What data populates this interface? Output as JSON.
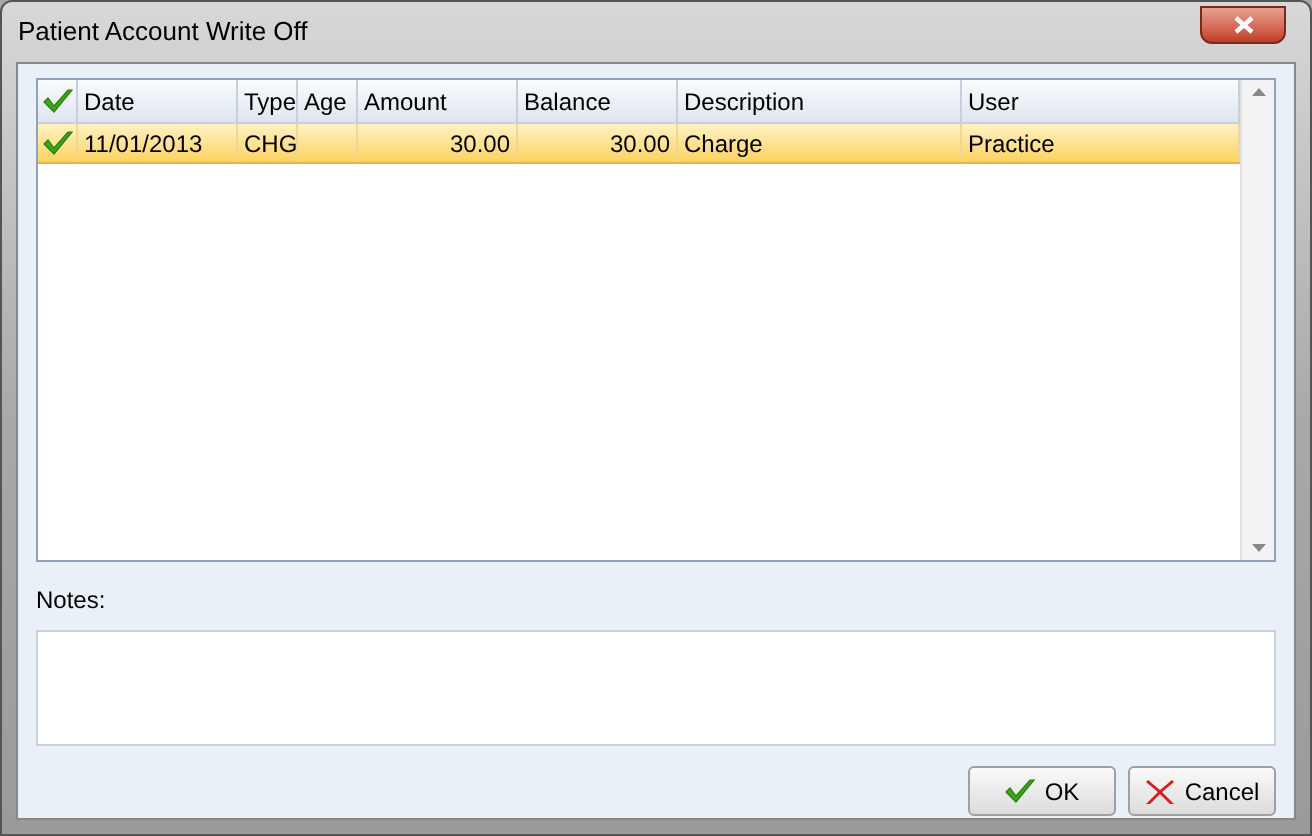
{
  "window": {
    "title": "Patient Account Write Off"
  },
  "table": {
    "columns": [
      "Date",
      "Type",
      "Age",
      "Amount",
      "Balance",
      "Description",
      "User"
    ],
    "rows": [
      {
        "checked": true,
        "selected": true,
        "cells": [
          "11/01/2013",
          "CHG",
          "",
          "30.00",
          "30.00",
          "Charge",
          "Practice"
        ]
      }
    ]
  },
  "notes": {
    "label": "Notes:"
  },
  "buttons": [
    {
      "kind": "ok",
      "label": "OK"
    },
    {
      "kind": "cancel",
      "label": "Cancel"
    }
  ]
}
